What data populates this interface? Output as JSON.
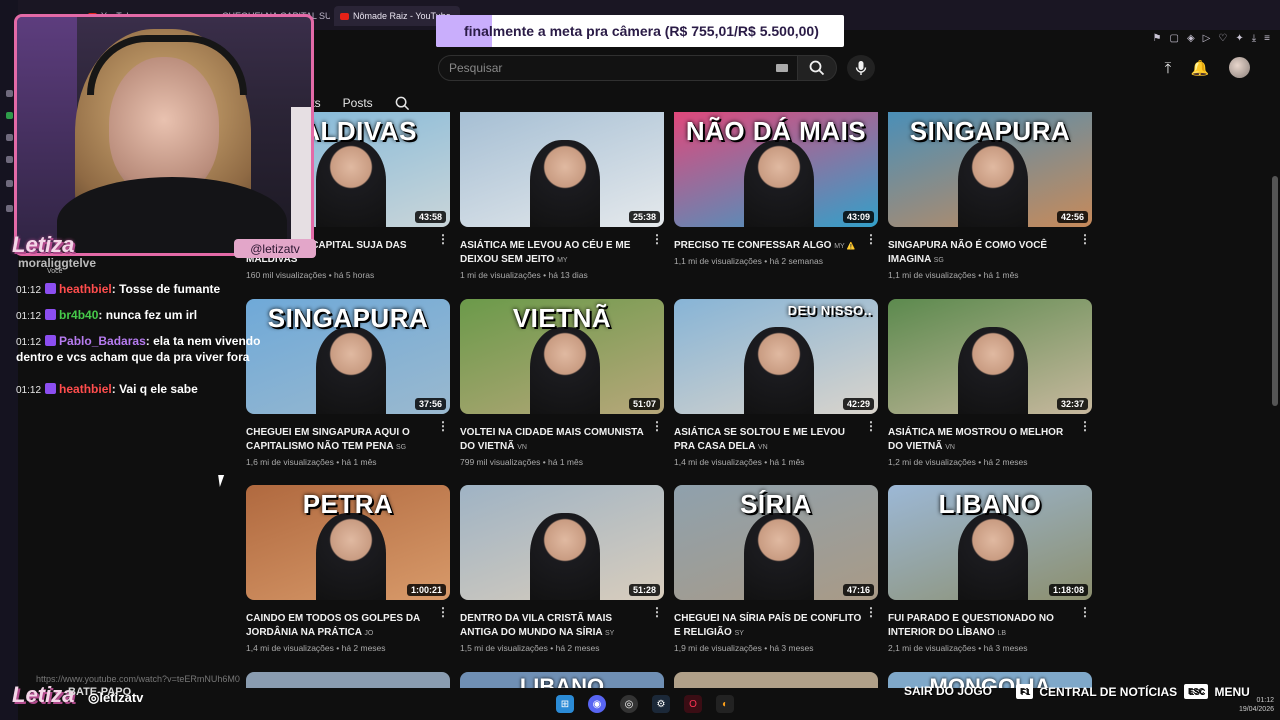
{
  "browser": {
    "tabs": [
      {
        "label": "YouTube"
      },
      {
        "label": "CHEGUEI NA CAPITAL SU..."
      },
      {
        "label": "Nômade Raiz - YouTube"
      }
    ]
  },
  "header": {
    "search_placeholder": "Pesquisar"
  },
  "channel_tabs": [
    "lists",
    "Posts"
  ],
  "goal_banner": {
    "text": "finalmente a meta pra câmera (R$ 755,01/R$ 5.500,00)",
    "progress": 0.137
  },
  "webcam": {
    "streamer_name": "Letiza",
    "handle": "@letizatv"
  },
  "chat": {
    "tail_line": "moraliggtelve",
    "voce_label": "Você",
    "messages": [
      {
        "time": "01:12",
        "user": "heathbiel",
        "user_color": "#ff4d4d",
        "text": "Tosse de fumante"
      },
      {
        "time": "01:12",
        "user": "br4b40",
        "user_color": "#46c94a",
        "text": "nunca fez um irl"
      },
      {
        "time": "01:12",
        "user": "Pablo_Badaras",
        "user_color": "#b77cf0",
        "text": "ela ta nem vivendo dentro e vcs acham que da pra viver fora"
      },
      {
        "time": "01:12",
        "user": "heathbiel",
        "user_color": "#ff4d4d",
        "text": "Vai q ele sabe"
      }
    ]
  },
  "videos": [
    {
      "thumb_text": "MALDIVAS",
      "duration": "43:58",
      "title": "CHEGUEI NA CAPITAL SUJA DAS MALDIVAS",
      "country": "",
      "views": "160 mil visualizações",
      "age": "há 5 horas",
      "colors": [
        "#7fb7d9",
        "#c9d5d9"
      ]
    },
    {
      "thumb_text": "",
      "duration": "25:38",
      "title": "ASIÁTICA ME LEVOU AO CÉU E ME DEIXOU SEM JEITO",
      "country": "MY",
      "views": "1 mi de visualizações",
      "age": "há 13 dias",
      "colors": [
        "#a6bfd4",
        "#e5e9ec"
      ]
    },
    {
      "thumb_text": "NÃO DÁ MAIS",
      "duration": "43:09",
      "title": "PRECISO TE CONFESSAR ALGO",
      "country": "MY ⚠️",
      "views": "1,1 mi de visualizações",
      "age": "há 2 semanas",
      "colors": [
        "#e0487b",
        "#33a0c9"
      ]
    },
    {
      "thumb_text": "SINGAPURA",
      "duration": "42:56",
      "title": "SINGAPURA NÃO É COMO VOCÊ IMAGINA",
      "country": "SG",
      "views": "1,1 mi de visualizações",
      "age": "há 1 mês",
      "colors": [
        "#4a8fb8",
        "#c78a5a"
      ]
    },
    {
      "thumb_text": "SINGAPURA",
      "duration": "37:56",
      "title": "CHEGUEI EM SINGAPURA AQUI O CAPITALISMO NÃO TEM PENA",
      "country": "SG",
      "views": "1,6 mi de visualizações",
      "age": "há 1 mês",
      "colors": [
        "#6fa9d8",
        "#9ab9cf"
      ]
    },
    {
      "thumb_text": "VIETNÃ",
      "duration": "51:07",
      "title": "VOLTEI NA CIDADE MAIS COMUNISTA DO VIETNÃ",
      "country": "VN",
      "views": "799 mil visualizações",
      "age": "há 1 mês",
      "colors": [
        "#6b9a4a",
        "#b7a77a"
      ]
    },
    {
      "thumb_text": "DEU NISSO..",
      "duration": "42:29",
      "title": "ASIÁTICA SE SOLTOU E ME LEVOU PRA CASA DELA",
      "country": "VN",
      "views": "1,4 mi de visualizações",
      "age": "há 1 mês",
      "colors": [
        "#87b4d6",
        "#d9d4cc"
      ]
    },
    {
      "thumb_text": "",
      "duration": "32:37",
      "title": "ASIÁTICA ME MOSTROU O MELHOR DO VIETNÃ",
      "country": "VN",
      "views": "1,2 mi de visualizações",
      "age": "há 2 meses",
      "colors": [
        "#5c8a4e",
        "#c7b89e"
      ]
    },
    {
      "thumb_text": "PETRA",
      "duration": "1:00:21",
      "title": "CAINDO EM TODOS OS GOLPES DA JORDÂNIA NA PRÁTICA",
      "country": "JO",
      "views": "1,4 mi de visualizações",
      "age": "há 2 meses",
      "colors": [
        "#b0693f",
        "#d89a6a"
      ]
    },
    {
      "thumb_text": "",
      "duration": "51:28",
      "title": "DENTRO DA VILA CRISTÃ MAIS ANTIGA DO MUNDO NA SÍRIA",
      "country": "SY",
      "views": "1,5 mi de visualizações",
      "age": "há 2 meses",
      "colors": [
        "#9fb3c4",
        "#d8cdbd"
      ]
    },
    {
      "thumb_text": "SÍRIA",
      "duration": "47:16",
      "title": "CHEGUEI NA SÍRIA PAÍS DE CONFLITO E RELIGIÃO",
      "country": "SY",
      "views": "1,9 mi de visualizações",
      "age": "há 3 meses",
      "colors": [
        "#8fa1ad",
        "#a99a86"
      ]
    },
    {
      "thumb_text": "LIBANO",
      "duration": "1:18:08",
      "title": "FUI PARADO E QUESTIONADO NO INTERIOR DO LÍBANO",
      "country": "LB",
      "views": "2,1 mi de visualizações",
      "age": "há 3 meses",
      "colors": [
        "#9cb8d6",
        "#8c8f6e"
      ]
    }
  ],
  "partial_row": [
    "",
    "LIBANO",
    "",
    "MONGOLIA"
  ],
  "bottom": {
    "url_hint": "https://www.youtube.com/watch?v=teERmNUh6M0",
    "logo": "Letiza",
    "chat_label": "BATE-PAPO",
    "instagram": "letizatv",
    "exit_game": "SAIR DO JOGO",
    "f1_key": "F1",
    "news_center": "CENTRAL DE NOTÍCIAS",
    "esc_key": "ESC",
    "menu": "MENU",
    "time": "01:12",
    "date": "19/04/2026"
  }
}
